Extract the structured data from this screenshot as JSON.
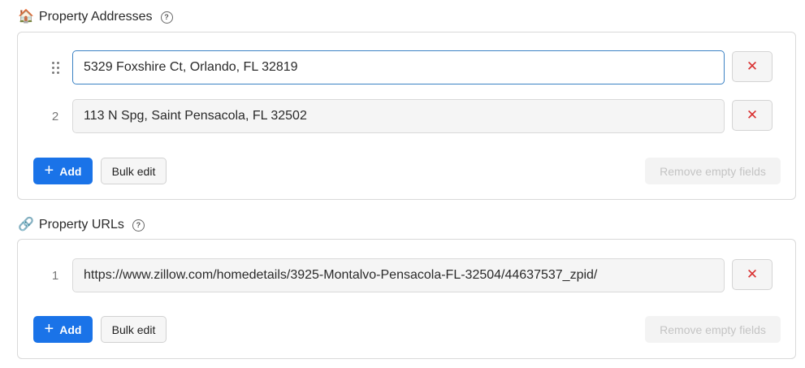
{
  "addresses_section": {
    "icon": "house-icon",
    "title": "Property Addresses",
    "help": "?",
    "rows": [
      {
        "index": "",
        "value": "5329 Foxshire Ct, Orlando, FL 32819"
      },
      {
        "index": "2",
        "value": "113 N Spg, Saint Pensacola, FL 32502"
      }
    ],
    "remove_glyph": "✕",
    "add_label": "Add",
    "add_glyph": "+",
    "bulk_label": "Bulk edit",
    "remove_empty_label": "Remove empty fields"
  },
  "urls_section": {
    "icon": "link-icon",
    "title": "Property URLs",
    "help": "?",
    "rows": [
      {
        "index": "1",
        "value": "https://www.zillow.com/homedetails/3925-Montalvo-Pensacola-FL-32504/44637537_zpid/"
      }
    ],
    "remove_glyph": "✕",
    "add_label": "Add",
    "add_glyph": "+",
    "bulk_label": "Bulk edit",
    "remove_empty_label": "Remove empty fields"
  },
  "colors": {
    "accent": "#1a73e8",
    "focus_border": "#3b82c4",
    "remove_red": "#d93030"
  }
}
